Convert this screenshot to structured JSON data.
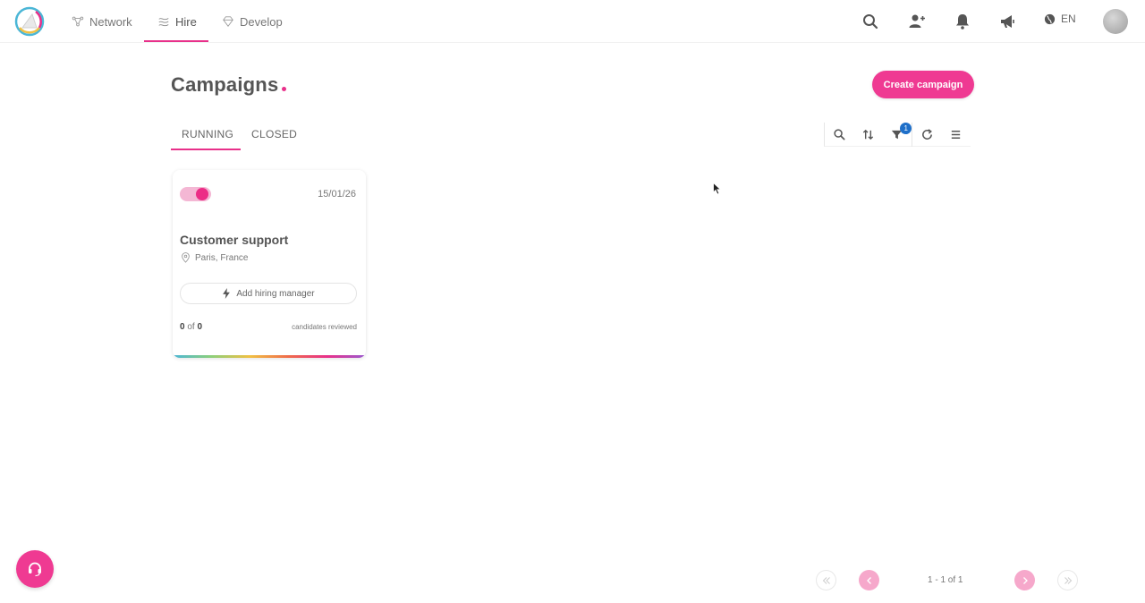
{
  "nav": {
    "items": [
      {
        "label": "Network",
        "icon": "network-icon"
      },
      {
        "label": "Hire",
        "icon": "hire-icon"
      },
      {
        "label": "Develop",
        "icon": "diamond-icon"
      }
    ],
    "active": "Hire",
    "language": "EN"
  },
  "page": {
    "title": "Campaigns",
    "create_button": "Create campaign"
  },
  "tabs": [
    {
      "label": "RUNNING",
      "active": true
    },
    {
      "label": "CLOSED",
      "active": false
    }
  ],
  "toolbar": {
    "filter_badge": "1"
  },
  "campaigns": [
    {
      "title": "Customer support",
      "date": "15/01/26",
      "location": "Paris, France",
      "active": true,
      "hiring_manager_button": "Add hiring manager",
      "reviewed": "0",
      "of_word": "of",
      "total": "0",
      "reviewed_label": "candidates reviewed"
    }
  ],
  "pagination": {
    "text": "1 - 1 of 1"
  },
  "colors": {
    "accent": "#ef3a92",
    "badge": "#1e6fc9",
    "text": "#555555"
  }
}
